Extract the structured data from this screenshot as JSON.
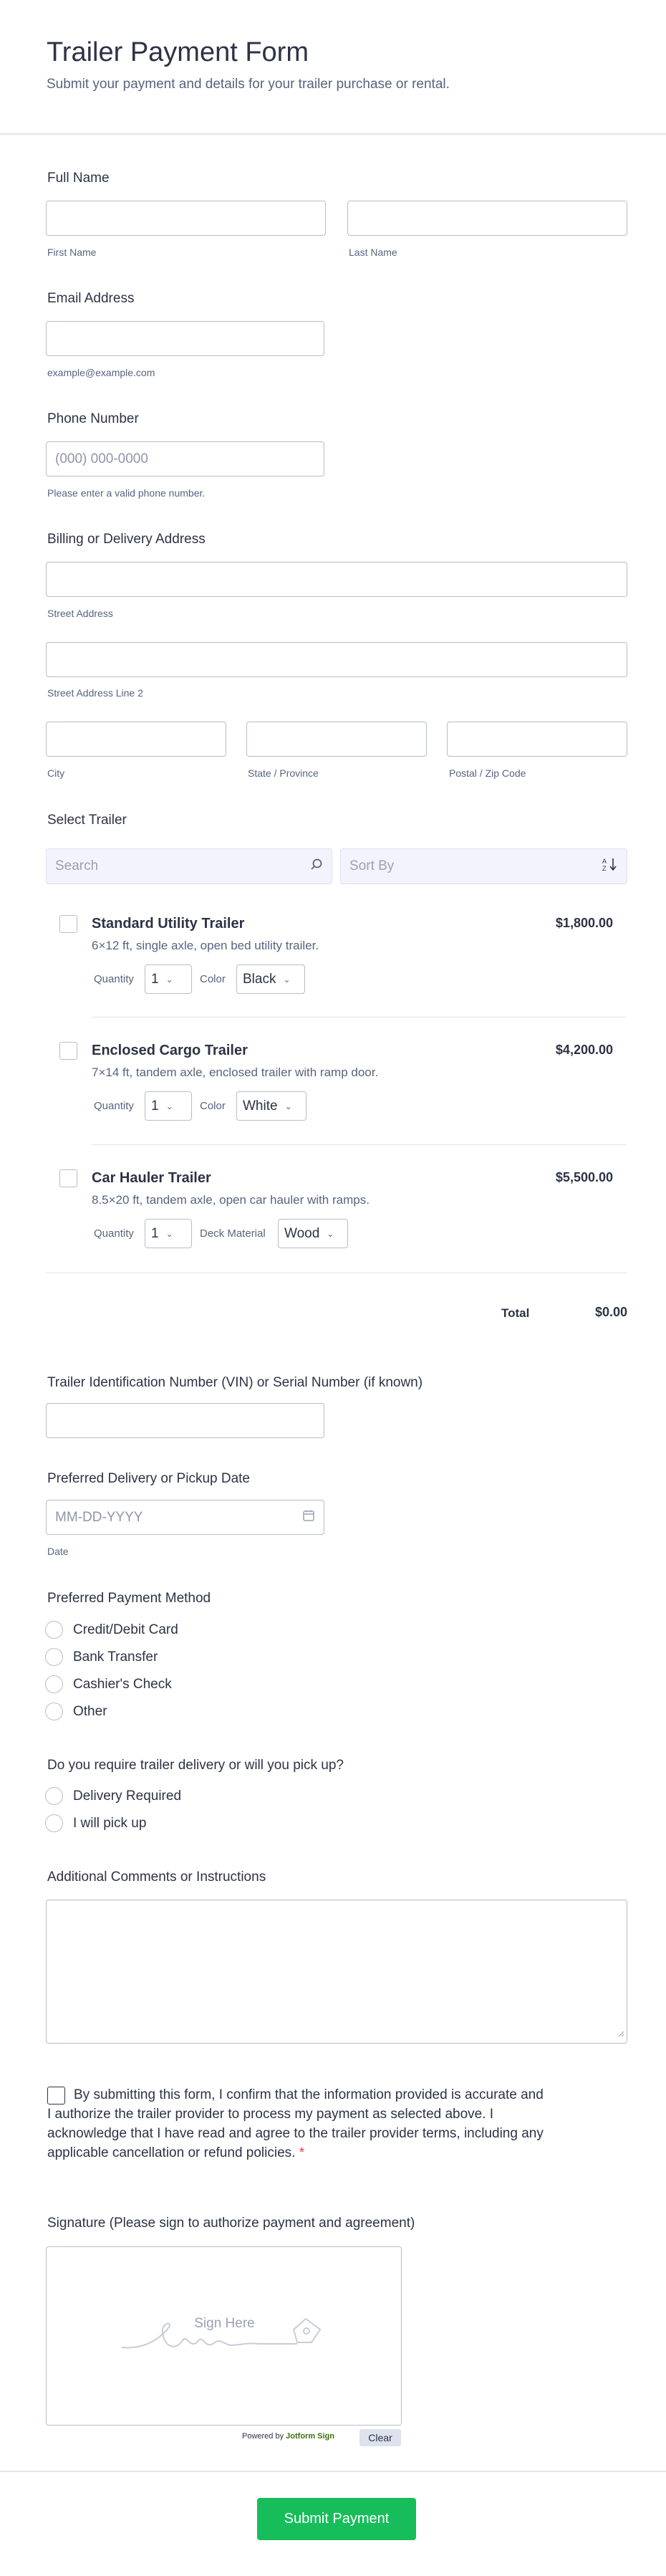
{
  "header": {
    "title": "Trailer Payment Form",
    "subtitle": "Submit your payment and details for your trailer purchase or rental."
  },
  "full_name": {
    "label": "Full Name",
    "first_sub": "First Name",
    "last_sub": "Last Name"
  },
  "email": {
    "label": "Email Address",
    "sub": "example@example.com"
  },
  "phone": {
    "label": "Phone Number",
    "placeholder": "(000) 000-0000",
    "sub": "Please enter a valid phone number."
  },
  "address": {
    "label": "Billing or Delivery Address",
    "street_sub": "Street Address",
    "street2_sub": "Street Address Line 2",
    "city_sub": "City",
    "state_sub": "State / Province",
    "zip_sub": "Postal / Zip Code"
  },
  "trailer": {
    "label": "Select Trailer",
    "search_placeholder": "Search",
    "sort_placeholder": "Sort By",
    "products": [
      {
        "name": "Standard Utility Trailer",
        "desc": "6×12 ft, single axle, open bed utility trailer.",
        "price": "$1,800.00",
        "qty_label": "Quantity",
        "qty": "1",
        "opt_label": "Color",
        "opt_value": "Black"
      },
      {
        "name": "Enclosed Cargo Trailer",
        "desc": "7×14 ft, tandem axle, enclosed trailer with ramp door.",
        "price": "$4,200.00",
        "qty_label": "Quantity",
        "qty": "1",
        "opt_label": "Color",
        "opt_value": "White"
      },
      {
        "name": "Car Hauler Trailer",
        "desc": "8.5×20 ft, tandem axle, open car hauler with ramps.",
        "price": "$5,500.00",
        "qty_label": "Quantity",
        "qty": "1",
        "opt_label": "Deck Material",
        "opt_value": "Wood"
      }
    ],
    "total_label": "Total",
    "total_value": "$0.00"
  },
  "vin": {
    "label": "Trailer Identification Number (VIN) or Serial Number (if known)"
  },
  "date": {
    "label": "Preferred Delivery or Pickup Date",
    "placeholder": "MM-DD-YYYY",
    "sub": "Date"
  },
  "payment": {
    "label": "Preferred Payment Method",
    "options": [
      "Credit/Debit Card",
      "Bank Transfer",
      "Cashier's Check",
      "Other"
    ]
  },
  "delivery": {
    "label": "Do you require trailer delivery or will you pick up?",
    "options": [
      "Delivery Required",
      "I will pick up"
    ]
  },
  "comments": {
    "label": "Additional Comments or Instructions"
  },
  "agreement": {
    "text": "By submitting this form, I confirm that the information provided is accurate and I authorize the trailer provider to process my payment as selected above. I acknowledge that I have read and agree to the trailer provider terms, including any applicable cancellation or refund policies.",
    "required_mark": "*"
  },
  "signature": {
    "label": "Signature (Please sign to authorize payment and agreement)",
    "placeholder": "Sign Here",
    "powered_prefix": "Powered by",
    "powered_brand": "Jotform Sign",
    "clear_label": "Clear"
  },
  "submit": {
    "label": "Submit Payment"
  },
  "colors": {
    "submit_bg": "#18bd5b",
    "text": "#2c3345",
    "muted": "#57647e",
    "required": "#f23a3c"
  }
}
